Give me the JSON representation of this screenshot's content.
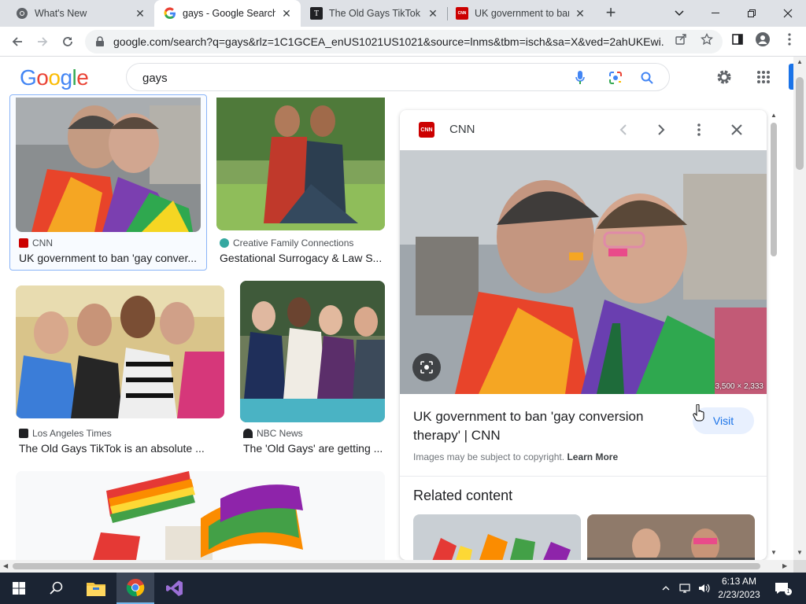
{
  "browser": {
    "tabs": [
      {
        "title": "What's New",
        "icon": "chrome-logo-icon",
        "active": false
      },
      {
        "title": "gays - Google Search",
        "icon": "google-g-icon",
        "active": true
      },
      {
        "title": "The Old Gays TikTok is",
        "icon": "la-times-icon",
        "active": false
      },
      {
        "title": "UK government to ban",
        "icon": "cnn-icon",
        "active": false
      }
    ],
    "url": "google.com/search?q=gays&rlz=1C1GCEA_enUS1021US1021&source=lnms&tbm=isch&sa=X&ved=2ahUKEwi..."
  },
  "google": {
    "logo": "Google",
    "query": "gays"
  },
  "results": [
    {
      "source": "CNN",
      "caption": "UK government to ban 'gay conver...",
      "icon_color": "#cc0000"
    },
    {
      "source": "Creative Family Connections",
      "caption": "Gestational Surrogacy & Law S...",
      "icon_color": "#34a8a0"
    },
    {
      "source": "Los Angeles Times",
      "caption": "The Old Gays TikTok is an absolute ...",
      "icon_color": "#202124"
    },
    {
      "source": "NBC News",
      "caption": "The 'Old Gays' are getting ...",
      "icon_color": "#202124"
    }
  ],
  "panel": {
    "source": "CNN",
    "logo_text": "CNN",
    "dimensions": "3,500 × 2,333",
    "title": "UK government to ban 'gay conversion therapy' | CNN",
    "visit": "Visit",
    "copyright": "Images may be subject to copyright.",
    "learn_more": "Learn More",
    "related": "Related content"
  },
  "taskbar": {
    "time": "6:13 AM",
    "date": "2/23/2023"
  },
  "colors": {
    "accent": "#1a73e8",
    "cnn_red": "#cc0000",
    "taskbar": "#1b2433"
  }
}
